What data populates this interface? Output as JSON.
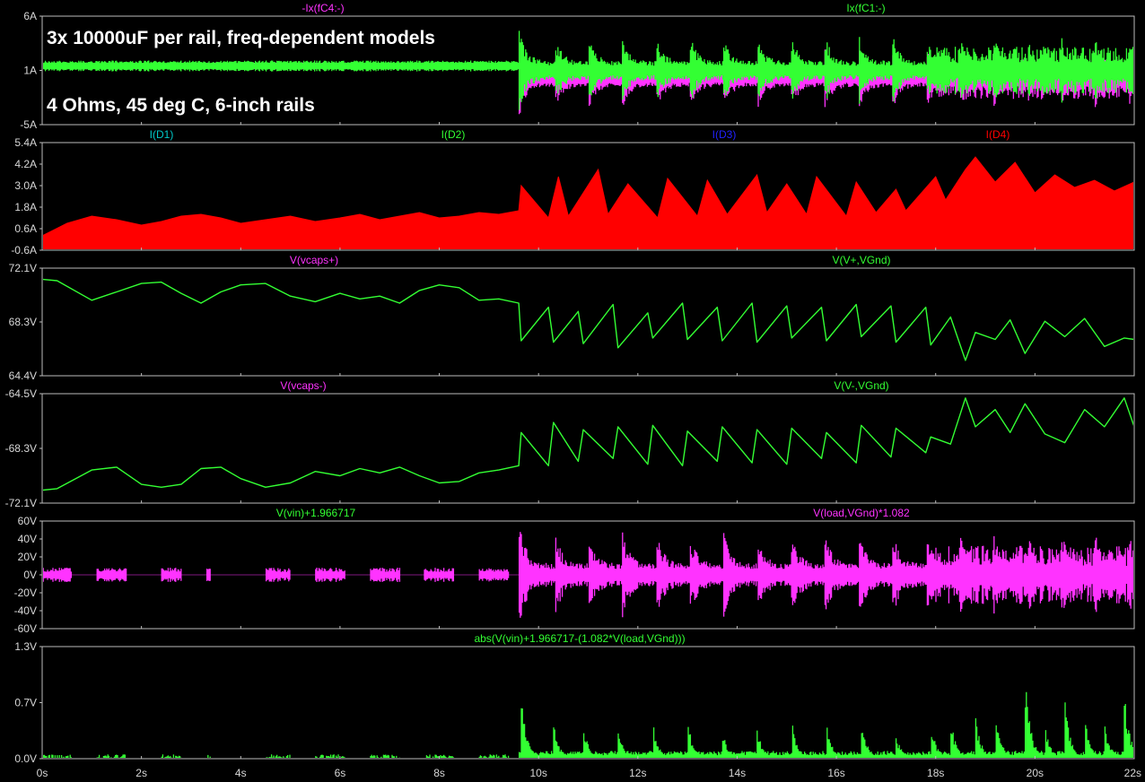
{
  "colors": {
    "background": "#000000",
    "frame": "#bdbdbd",
    "tick_text": "#d8d8d8",
    "magenta": "#ff33ff",
    "green": "#33ff33",
    "cyan": "#00c8c8",
    "lightgreen": "#33ff33",
    "blue": "#2222ff",
    "red": "#ff0000"
  },
  "annotations": [
    "3x 10000uF per rail, freq-dependent models",
    "4 Ohms, 45 deg C, 6-inch rails"
  ],
  "chart_data": [
    {
      "type": "line",
      "x_ticks": [
        "0s",
        "2s",
        "4s",
        "6s",
        "8s",
        "10s",
        "12s",
        "14s",
        "16s",
        "18s",
        "20s",
        "22s"
      ],
      "xlim": [
        0,
        22
      ],
      "traces": [
        {
          "name": "-Ix(fC4:-)",
          "color": "magenta"
        },
        {
          "name": "Ix(fC1:-)",
          "color": "green"
        }
      ],
      "y_ticks": [
        "6A",
        "1A",
        "-5A"
      ],
      "ylim": [
        -5,
        6
      ],
      "series": [
        {
          "name": "-Ix(fC4:-)",
          "kind": "envelope",
          "color": "magenta",
          "x": [
            0,
            9.6,
            9.6,
            22
          ],
          "upper": [
            1.3,
            1.3,
            3.0,
            3.0
          ],
          "lower": [
            0.6,
            0.6,
            -3.6,
            -3.6
          ]
        },
        {
          "name": "Ix(fC1:-)",
          "kind": "envelope",
          "color": "green",
          "x": [
            0,
            9.6,
            9.6,
            22
          ],
          "upper": [
            1.5,
            1.5,
            4.2,
            4.2
          ],
          "lower": [
            0.4,
            0.4,
            -3.2,
            -3.2
          ]
        }
      ]
    },
    {
      "type": "area",
      "x_ticks": [
        "0s",
        "2s",
        "4s",
        "6s",
        "8s",
        "10s",
        "12s",
        "14s",
        "16s",
        "18s",
        "20s",
        "22s"
      ],
      "xlim": [
        0,
        22
      ],
      "traces": [
        {
          "name": "I(D1)",
          "color": "cyan"
        },
        {
          "name": "I(D2)",
          "color": "lightgreen"
        },
        {
          "name": "I(D3)",
          "color": "blue"
        },
        {
          "name": "I(D4)",
          "color": "red"
        }
      ],
      "y_ticks": [
        "5.4A",
        "4.2A",
        "3.0A",
        "1.8A",
        "0.6A",
        "-0.6A"
      ],
      "ylim": [
        -0.6,
        5.4
      ],
      "series": [
        {
          "name": "I(D4)",
          "color": "red",
          "x": [
            0,
            0.5,
            1.0,
            1.5,
            2.0,
            2.4,
            2.8,
            3.2,
            3.6,
            4.0,
            4.5,
            5.0,
            5.5,
            6.0,
            6.4,
            6.8,
            7.2,
            7.6,
            8.0,
            8.4,
            8.8,
            9.2,
            9.6,
            9.65,
            10.2,
            10.4,
            10.6,
            11.2,
            11.4,
            11.8,
            12.4,
            12.6,
            13.2,
            13.4,
            13.8,
            14.4,
            14.6,
            15.0,
            15.4,
            15.6,
            16.2,
            16.4,
            16.8,
            17.2,
            17.4,
            18.0,
            18.2,
            18.6,
            18.8,
            19.2,
            19.6,
            20.0,
            20.4,
            20.8,
            21.2,
            21.6,
            22.0
          ],
          "y": [
            0.2,
            0.9,
            1.3,
            1.1,
            0.8,
            1.0,
            1.3,
            1.4,
            1.2,
            0.9,
            1.1,
            1.3,
            1.0,
            1.2,
            1.4,
            1.1,
            1.3,
            1.5,
            1.2,
            1.3,
            1.5,
            1.4,
            1.6,
            3.0,
            1.2,
            3.5,
            1.3,
            3.9,
            1.4,
            3.1,
            1.2,
            3.4,
            1.3,
            3.3,
            1.4,
            3.6,
            1.5,
            3.1,
            1.4,
            3.5,
            1.3,
            3.2,
            1.5,
            2.8,
            1.6,
            3.5,
            2.2,
            3.9,
            4.6,
            3.2,
            4.3,
            2.6,
            3.6,
            2.9,
            3.3,
            2.7,
            3.2
          ]
        }
      ]
    },
    {
      "type": "line",
      "x_ticks": [
        "0s",
        "2s",
        "4s",
        "6s",
        "8s",
        "10s",
        "12s",
        "14s",
        "16s",
        "18s",
        "20s",
        "22s"
      ],
      "xlim": [
        0,
        22
      ],
      "traces": [
        {
          "name": "V(vcaps+)",
          "color": "magenta"
        },
        {
          "name": "V(V+,VGnd)",
          "color": "green"
        }
      ],
      "y_ticks": [
        "72.1V",
        "68.3V",
        "64.4V"
      ],
      "ylim": [
        64.4,
        72.1
      ],
      "series": [
        {
          "name": "V(V+,VGnd)",
          "color": "green",
          "x": [
            0,
            0.3,
            1.0,
            1.5,
            2.0,
            2.4,
            2.8,
            3.2,
            3.6,
            4.0,
            4.5,
            5.0,
            5.5,
            6.0,
            6.4,
            6.8,
            7.2,
            7.6,
            8.0,
            8.4,
            8.8,
            9.2,
            9.6,
            9.65,
            10.2,
            10.3,
            10.8,
            10.9,
            11.5,
            11.6,
            12.2,
            12.3,
            12.9,
            13.0,
            13.6,
            13.7,
            14.3,
            14.4,
            15.0,
            15.1,
            15.7,
            15.8,
            16.4,
            16.5,
            17.1,
            17.2,
            17.8,
            17.9,
            18.3,
            18.6,
            18.8,
            19.2,
            19.5,
            19.8,
            20.2,
            20.6,
            21.0,
            21.4,
            21.8,
            22.0
          ],
          "y": [
            71.3,
            71.2,
            69.8,
            70.4,
            71.0,
            71.1,
            70.3,
            69.6,
            70.4,
            70.9,
            71.0,
            70.1,
            69.7,
            70.3,
            69.9,
            70.1,
            69.6,
            70.5,
            70.9,
            70.7,
            69.8,
            69.9,
            69.6,
            66.9,
            69.3,
            66.8,
            69.0,
            66.7,
            69.5,
            66.4,
            68.9,
            67.1,
            69.6,
            67.0,
            69.3,
            66.9,
            69.6,
            66.8,
            69.4,
            67.1,
            69.3,
            66.9,
            69.5,
            67.2,
            69.4,
            66.8,
            69.3,
            66.6,
            68.6,
            65.5,
            67.5,
            67.0,
            68.4,
            66.0,
            68.3,
            67.2,
            68.5,
            66.5,
            67.1,
            67.0
          ]
        }
      ]
    },
    {
      "type": "line",
      "x_ticks": [
        "0s",
        "2s",
        "4s",
        "6s",
        "8s",
        "10s",
        "12s",
        "14s",
        "16s",
        "18s",
        "20s",
        "22s"
      ],
      "xlim": [
        0,
        22
      ],
      "traces": [
        {
          "name": "V(vcaps-)",
          "color": "magenta"
        },
        {
          "name": "V(V-,VGnd)",
          "color": "green"
        }
      ],
      "y_ticks": [
        "-64.5V",
        "-68.3V",
        "-72.1V"
      ],
      "ylim": [
        -72.1,
        -64.5
      ],
      "series": [
        {
          "name": "V(V-,VGnd)",
          "color": "green",
          "x": [
            0,
            0.3,
            1.0,
            1.5,
            2.0,
            2.4,
            2.8,
            3.2,
            3.6,
            4.0,
            4.5,
            5.0,
            5.5,
            6.0,
            6.4,
            6.8,
            7.2,
            7.6,
            8.0,
            8.4,
            8.8,
            9.2,
            9.6,
            9.65,
            10.2,
            10.3,
            10.8,
            10.9,
            11.5,
            11.6,
            12.2,
            12.3,
            12.9,
            13.0,
            13.6,
            13.7,
            14.3,
            14.4,
            15.0,
            15.1,
            15.7,
            15.8,
            16.4,
            16.5,
            17.1,
            17.2,
            17.8,
            17.9,
            18.3,
            18.6,
            18.8,
            19.2,
            19.5,
            19.8,
            20.2,
            20.6,
            21.0,
            21.4,
            21.8,
            22.0
          ],
          "y": [
            -71.2,
            -71.1,
            -69.8,
            -69.6,
            -70.8,
            -71.0,
            -70.8,
            -69.7,
            -69.6,
            -70.4,
            -71.0,
            -70.7,
            -69.9,
            -70.2,
            -69.7,
            -70.0,
            -69.6,
            -70.2,
            -70.7,
            -70.6,
            -70.0,
            -69.8,
            -69.5,
            -67.2,
            -69.5,
            -66.5,
            -69.2,
            -67.0,
            -69.0,
            -66.8,
            -69.4,
            -66.7,
            -69.5,
            -67.1,
            -69.2,
            -66.8,
            -69.3,
            -67.0,
            -69.4,
            -66.9,
            -69.0,
            -67.2,
            -69.3,
            -66.7,
            -68.9,
            -66.9,
            -68.6,
            -67.5,
            -68.0,
            -64.8,
            -66.8,
            -65.6,
            -67.2,
            -65.2,
            -67.3,
            -67.9,
            -65.6,
            -66.8,
            -64.8,
            -66.8
          ]
        }
      ]
    },
    {
      "type": "line",
      "x_ticks": [
        "0s",
        "2s",
        "4s",
        "6s",
        "8s",
        "10s",
        "12s",
        "14s",
        "16s",
        "18s",
        "20s",
        "22s"
      ],
      "xlim": [
        0,
        22
      ],
      "traces": [
        {
          "name": "V(vin)+1.966717",
          "color": "green"
        },
        {
          "name": "V(load,VGnd)*1.082",
          "color": "magenta"
        }
      ],
      "y_ticks": [
        "60V",
        "40V",
        "20V",
        "0V",
        "-20V",
        "-40V",
        "-60V"
      ],
      "ylim": [
        -60,
        60
      ],
      "series": [
        {
          "name": "V(load,VGnd)*1.082",
          "kind": "envelope",
          "color": "magenta",
          "x": [
            0,
            9.6,
            9.6,
            22
          ],
          "upper": [
            8,
            8,
            50,
            50
          ],
          "lower": [
            -8,
            -8,
            -50,
            -50
          ]
        }
      ]
    },
    {
      "type": "line",
      "x_ticks": [
        "0s",
        "2s",
        "4s",
        "6s",
        "8s",
        "10s",
        "12s",
        "14s",
        "16s",
        "18s",
        "20s",
        "22s"
      ],
      "xlim": [
        0,
        22
      ],
      "traces": [
        {
          "name": "abs(V(vin)+1.966717-(1.082*V(load,VGnd)))",
          "color": "green"
        }
      ],
      "y_ticks": [
        "1.3V",
        "0.7V",
        "0.0V"
      ],
      "ylim": [
        0,
        1.3
      ],
      "series": [
        {
          "name": "abs(V(vin)+1.966717-(1.082*V(load,VGnd)))",
          "kind": "spikes",
          "color": "green",
          "x": [
            9.65,
            10.3,
            10.9,
            11.6,
            12.3,
            13.0,
            13.7,
            14.4,
            15.1,
            15.8,
            16.5,
            17.2,
            17.9,
            18.3,
            18.8,
            19.2,
            19.8,
            20.2,
            20.6,
            21.0,
            21.4,
            21.8
          ],
          "y": [
            0.75,
            0.45,
            0.42,
            0.38,
            0.45,
            0.5,
            0.35,
            0.4,
            0.52,
            0.42,
            0.5,
            0.3,
            0.44,
            0.5,
            0.55,
            0.68,
            1.03,
            0.4,
            0.72,
            0.55,
            0.45,
            0.8
          ]
        }
      ]
    }
  ]
}
